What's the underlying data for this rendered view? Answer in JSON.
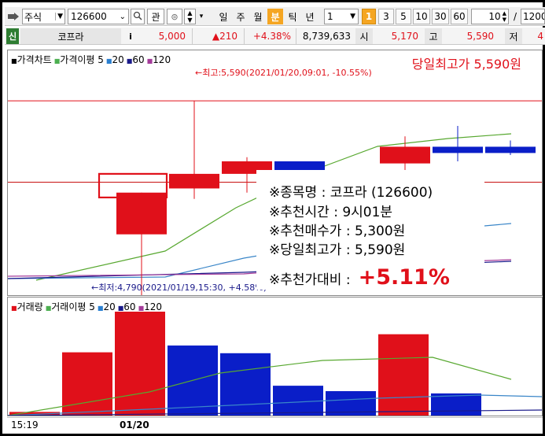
{
  "toolbar": {
    "market": "주식",
    "code": "126600",
    "btn_gwan": "관",
    "period_tabs": [
      "일",
      "주",
      "월",
      "분",
      "틱",
      "년"
    ],
    "active_period": "분",
    "interval_value": "1",
    "minute_buttons": [
      "1",
      "3",
      "5",
      "10",
      "30",
      "60"
    ],
    "active_minute": "1",
    "count_value": "10",
    "slash": "/",
    "max_count": "1200"
  },
  "quote": {
    "credit_badge": "신",
    "name": "코프라",
    "info_btn": "i",
    "price": "5,000",
    "change": "▲210",
    "change_rate": "+4.38%",
    "volume": "8,739,633",
    "open_label": "시",
    "open_value": "5,170",
    "high_label": "고",
    "high_value": "5,590",
    "low_label": "저",
    "low_value_partial": "4"
  },
  "price_panel": {
    "legend": [
      {
        "text": "가격차트",
        "color": "#000000",
        "mark": "■"
      },
      {
        "text": "가격이평 5",
        "color": "#4caf50",
        "mark": "■"
      },
      {
        "text": "20",
        "color": "#2a7fd0",
        "mark": "■"
      },
      {
        "text": "60",
        "color": "#1a1a8a",
        "mark": "■"
      },
      {
        "text": "120",
        "color": "#a43b9a",
        "mark": "■"
      }
    ],
    "headline": "당일최고가 5,590원",
    "high_marker": "←최고:5,590(2021/01/20,09:01, -10.55%)",
    "low_marker": "←최저:4,790(2021/01/19,15:30, +4.58%)"
  },
  "info_box": {
    "line1": "※종목명 : 코프라 (126600)",
    "line2": "※추천시간 : 9시01분",
    "line3": "※추천매수가 : 5,300원",
    "line4": "※당일최고가 : 5,590원",
    "line5_prefix": "※추천가대비 :",
    "line5_value": "+5.11%"
  },
  "volume_panel": {
    "legend": [
      {
        "text": "거래량",
        "color": "#e0101a",
        "mark": "■"
      },
      {
        "text": "거래이평 5",
        "color": "#4caf50",
        "mark": "■"
      },
      {
        "text": "20",
        "color": "#2a7fd0",
        "mark": "■"
      },
      {
        "text": "60",
        "color": "#1a1a8a",
        "mark": "■"
      },
      {
        "text": "120",
        "color": "#a43b9a",
        "mark": "■"
      }
    ]
  },
  "x_axis": {
    "labels": [
      "15:19",
      "01/20"
    ]
  },
  "colors": {
    "up": "#e0101a",
    "down": "#0a1ec8",
    "ma5": "#58a830",
    "ma20": "#3a86c8",
    "ma60": "#1a1a8a",
    "ma120": "#a43b9a",
    "highlight": "#f5a623"
  },
  "chart_data": {
    "type": "candlestick",
    "price_axis": {
      "min": 4700,
      "max": 5700
    },
    "candles": [
      {
        "o": 5150,
        "h": 5150,
        "l": 4790,
        "c": 4950,
        "dir": "up"
      },
      {
        "o": 5170,
        "h": 5590,
        "l": 5120,
        "c": 5240,
        "dir": "up"
      },
      {
        "o": 5240,
        "h": 5320,
        "l": 5150,
        "c": 5300,
        "dir": "up"
      },
      {
        "o": 5300,
        "h": 5300,
        "l": 5120,
        "c": 5200,
        "dir": "down"
      },
      {
        "o": 5200,
        "h": 5230,
        "l": 5180,
        "c": 5230,
        "dir": "up"
      },
      {
        "o": 5290,
        "h": 5420,
        "l": 5150,
        "c": 5370,
        "dir": "up"
      },
      {
        "o": 5370,
        "h": 5470,
        "l": 5300,
        "c": 5340,
        "dir": "down"
      },
      {
        "o": 5370,
        "h": 5400,
        "l": 5330,
        "c": 5340,
        "dir": "down"
      }
    ],
    "volume": [
      {
        "v": 80,
        "dir": "up"
      },
      {
        "v": 1400,
        "dir": "up"
      },
      {
        "v": 2300,
        "dir": "up"
      },
      {
        "v": 1550,
        "dir": "down"
      },
      {
        "v": 1380,
        "dir": "down"
      },
      {
        "v": 660,
        "dir": "down"
      },
      {
        "v": 540,
        "dir": "down"
      },
      {
        "v": 1800,
        "dir": "up"
      },
      {
        "v": 490,
        "dir": "down"
      }
    ],
    "volume_axis": {
      "max": 2300
    }
  }
}
